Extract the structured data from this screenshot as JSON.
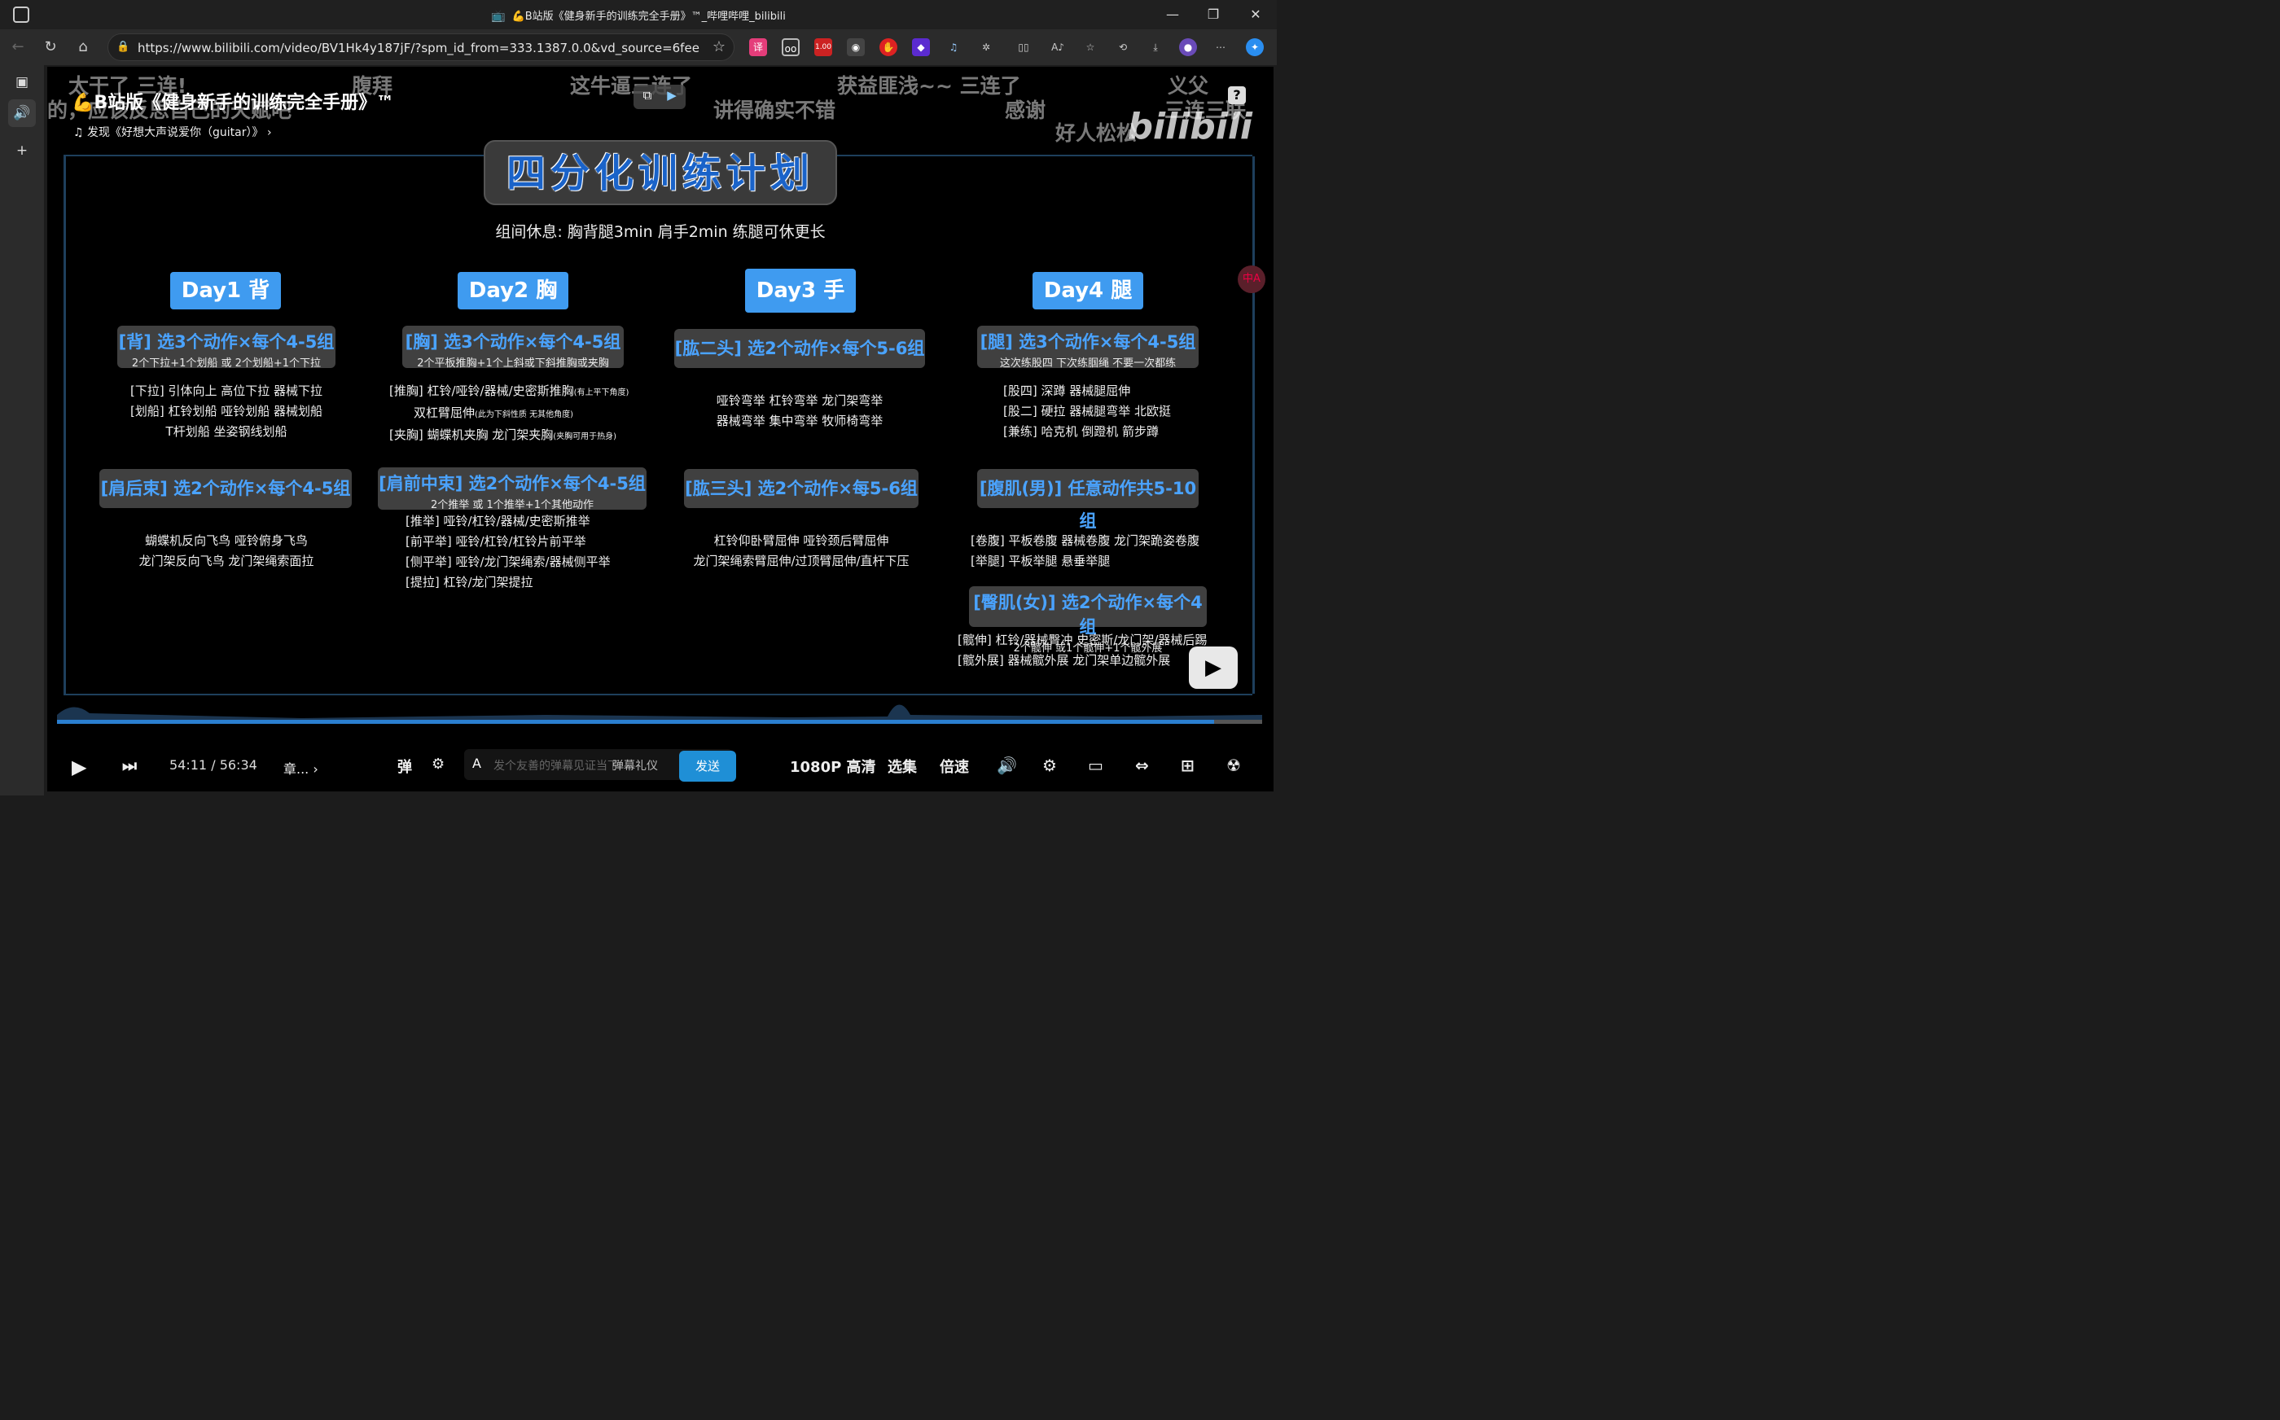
{
  "window": {
    "title": "💪B站版《健身新手的训练完全手册》™_哔哩哔哩_bilibili"
  },
  "address_bar": {
    "url": "https://www.bilibili.com/video/BV1Hk4y187jF/?spm_id_from=333.1387.0.0&vd_source=6fee5888cf...",
    "ext_badge": "1.00"
  },
  "video": {
    "title": "💪B站版《健身新手的训练完全手册》™",
    "music": "发现《好想大声说爱你（guitar）》",
    "logo": "bilibili",
    "danmaku": [
      "太干了 三连!",
      "的，应该反思自己的天赋吧",
      "腹拜",
      "这牛逼三连了",
      "讲得确实不错",
      "获益匪浅~~ 三连了",
      "感谢",
      "义父",
      "三连三联",
      "好人松松"
    ],
    "plan_title": "四分化训练计划",
    "rest_note": "组间休息: 胸背腿3min 肩手2min 练腿可休更长",
    "days": [
      {
        "label": "Day1 背",
        "blocks": [
          {
            "head": "[背] 选3个动作×每个4-5组",
            "sub": "2个下拉+1个划船 或 2个划船+1个下拉",
            "lines": [
              "[下拉] 引体向上 高位下拉 器械下拉",
              "[划船] 杠铃划船 哑铃划船 器械划船",
              "T杆划船  坐姿钢线划船"
            ]
          },
          {
            "head": "[肩后束] 选2个动作×每个4-5组",
            "sub": "",
            "lines": [
              "蝴蝶机反向飞鸟 哑铃俯身飞鸟",
              "龙门架反向飞鸟 龙门架绳索面拉"
            ]
          }
        ]
      },
      {
        "label": "Day2 胸",
        "blocks": [
          {
            "head": "[胸] 选3个动作×每个4-5组",
            "sub": "2个平板推胸+1个上斜或下斜推胸或夹胸",
            "lines": [
              "[推胸] 杠铃/哑铃/器械/史密斯推胸",
              "双杠臂屈伸",
              "[夹胸] 蝴蝶机夹胸 龙门架夹胸"
            ],
            "notes": [
              "(有上平下角度)",
              "(此为下斜性质 无其他角度)",
              "(夹胸可用于热身)"
            ]
          },
          {
            "head": "[肩前中束] 选2个动作×每个4-5组",
            "sub": "2个推举 或 1个推举+1个其他动作",
            "lines": [
              "[推举] 哑铃/杠铃/器械/史密斯推举",
              "[前平举] 哑铃/杠铃/杠铃片前平举",
              "[侧平举] 哑铃/龙门架绳索/器械侧平举",
              "[提拉] 杠铃/龙门架提拉"
            ]
          }
        ]
      },
      {
        "label": "Day3 手",
        "blocks": [
          {
            "head": "[肱二头] 选2个动作×每个5-6组",
            "sub": "",
            "lines": [
              "哑铃弯举 杠铃弯举 龙门架弯举",
              "器械弯举 集中弯举 牧师椅弯举"
            ]
          },
          {
            "head": "[肱三头] 选2个动作×每5-6组",
            "sub": "",
            "lines": [
              "杠铃仰卧臂屈伸 哑铃颈后臂屈伸",
              "龙门架绳索臂屈伸/过顶臂屈伸/直杆下压"
            ]
          }
        ]
      },
      {
        "label": "Day4 腿",
        "blocks": [
          {
            "head": "[腿] 选3个动作×每个4-5组",
            "sub": "这次练股四 下次练腘绳 不要一次都练",
            "lines": [
              "[股四] 深蹲 器械腿屈伸",
              "[股二] 硬拉 器械腿弯举 北欧挺",
              "[兼练] 哈克机 倒蹬机 箭步蹲"
            ]
          },
          {
            "head": "[腹肌(男)] 任意动作共5-10组",
            "sub": "",
            "lines": [
              "[卷腹] 平板卷腹 器械卷腹 龙门架跪姿卷腹",
              "[举腿] 平板举腿 悬垂举腿"
            ]
          },
          {
            "head": "[臀肌(女)] 选2个动作×每个4组",
            "sub": "2个髋伸 或1个髋伸+1个髋外展",
            "lines": [
              "[髋伸] 杠铃/器械臀冲 史密斯/龙门架/器械后踢",
              "[髋外展] 器械髋外展 龙门架单边髋外展"
            ]
          }
        ]
      }
    ]
  },
  "controls": {
    "time_current": "54:11",
    "time_sep": "/",
    "time_total": "56:34",
    "chapter": "章...",
    "danmaku_placeholder": "发个友善的弹幕见证当下",
    "gift": "弹幕礼仪",
    "send": "发送",
    "quality": "1080P 高清",
    "episodes": "选集",
    "speed": "倍速",
    "progress": 0.96
  }
}
